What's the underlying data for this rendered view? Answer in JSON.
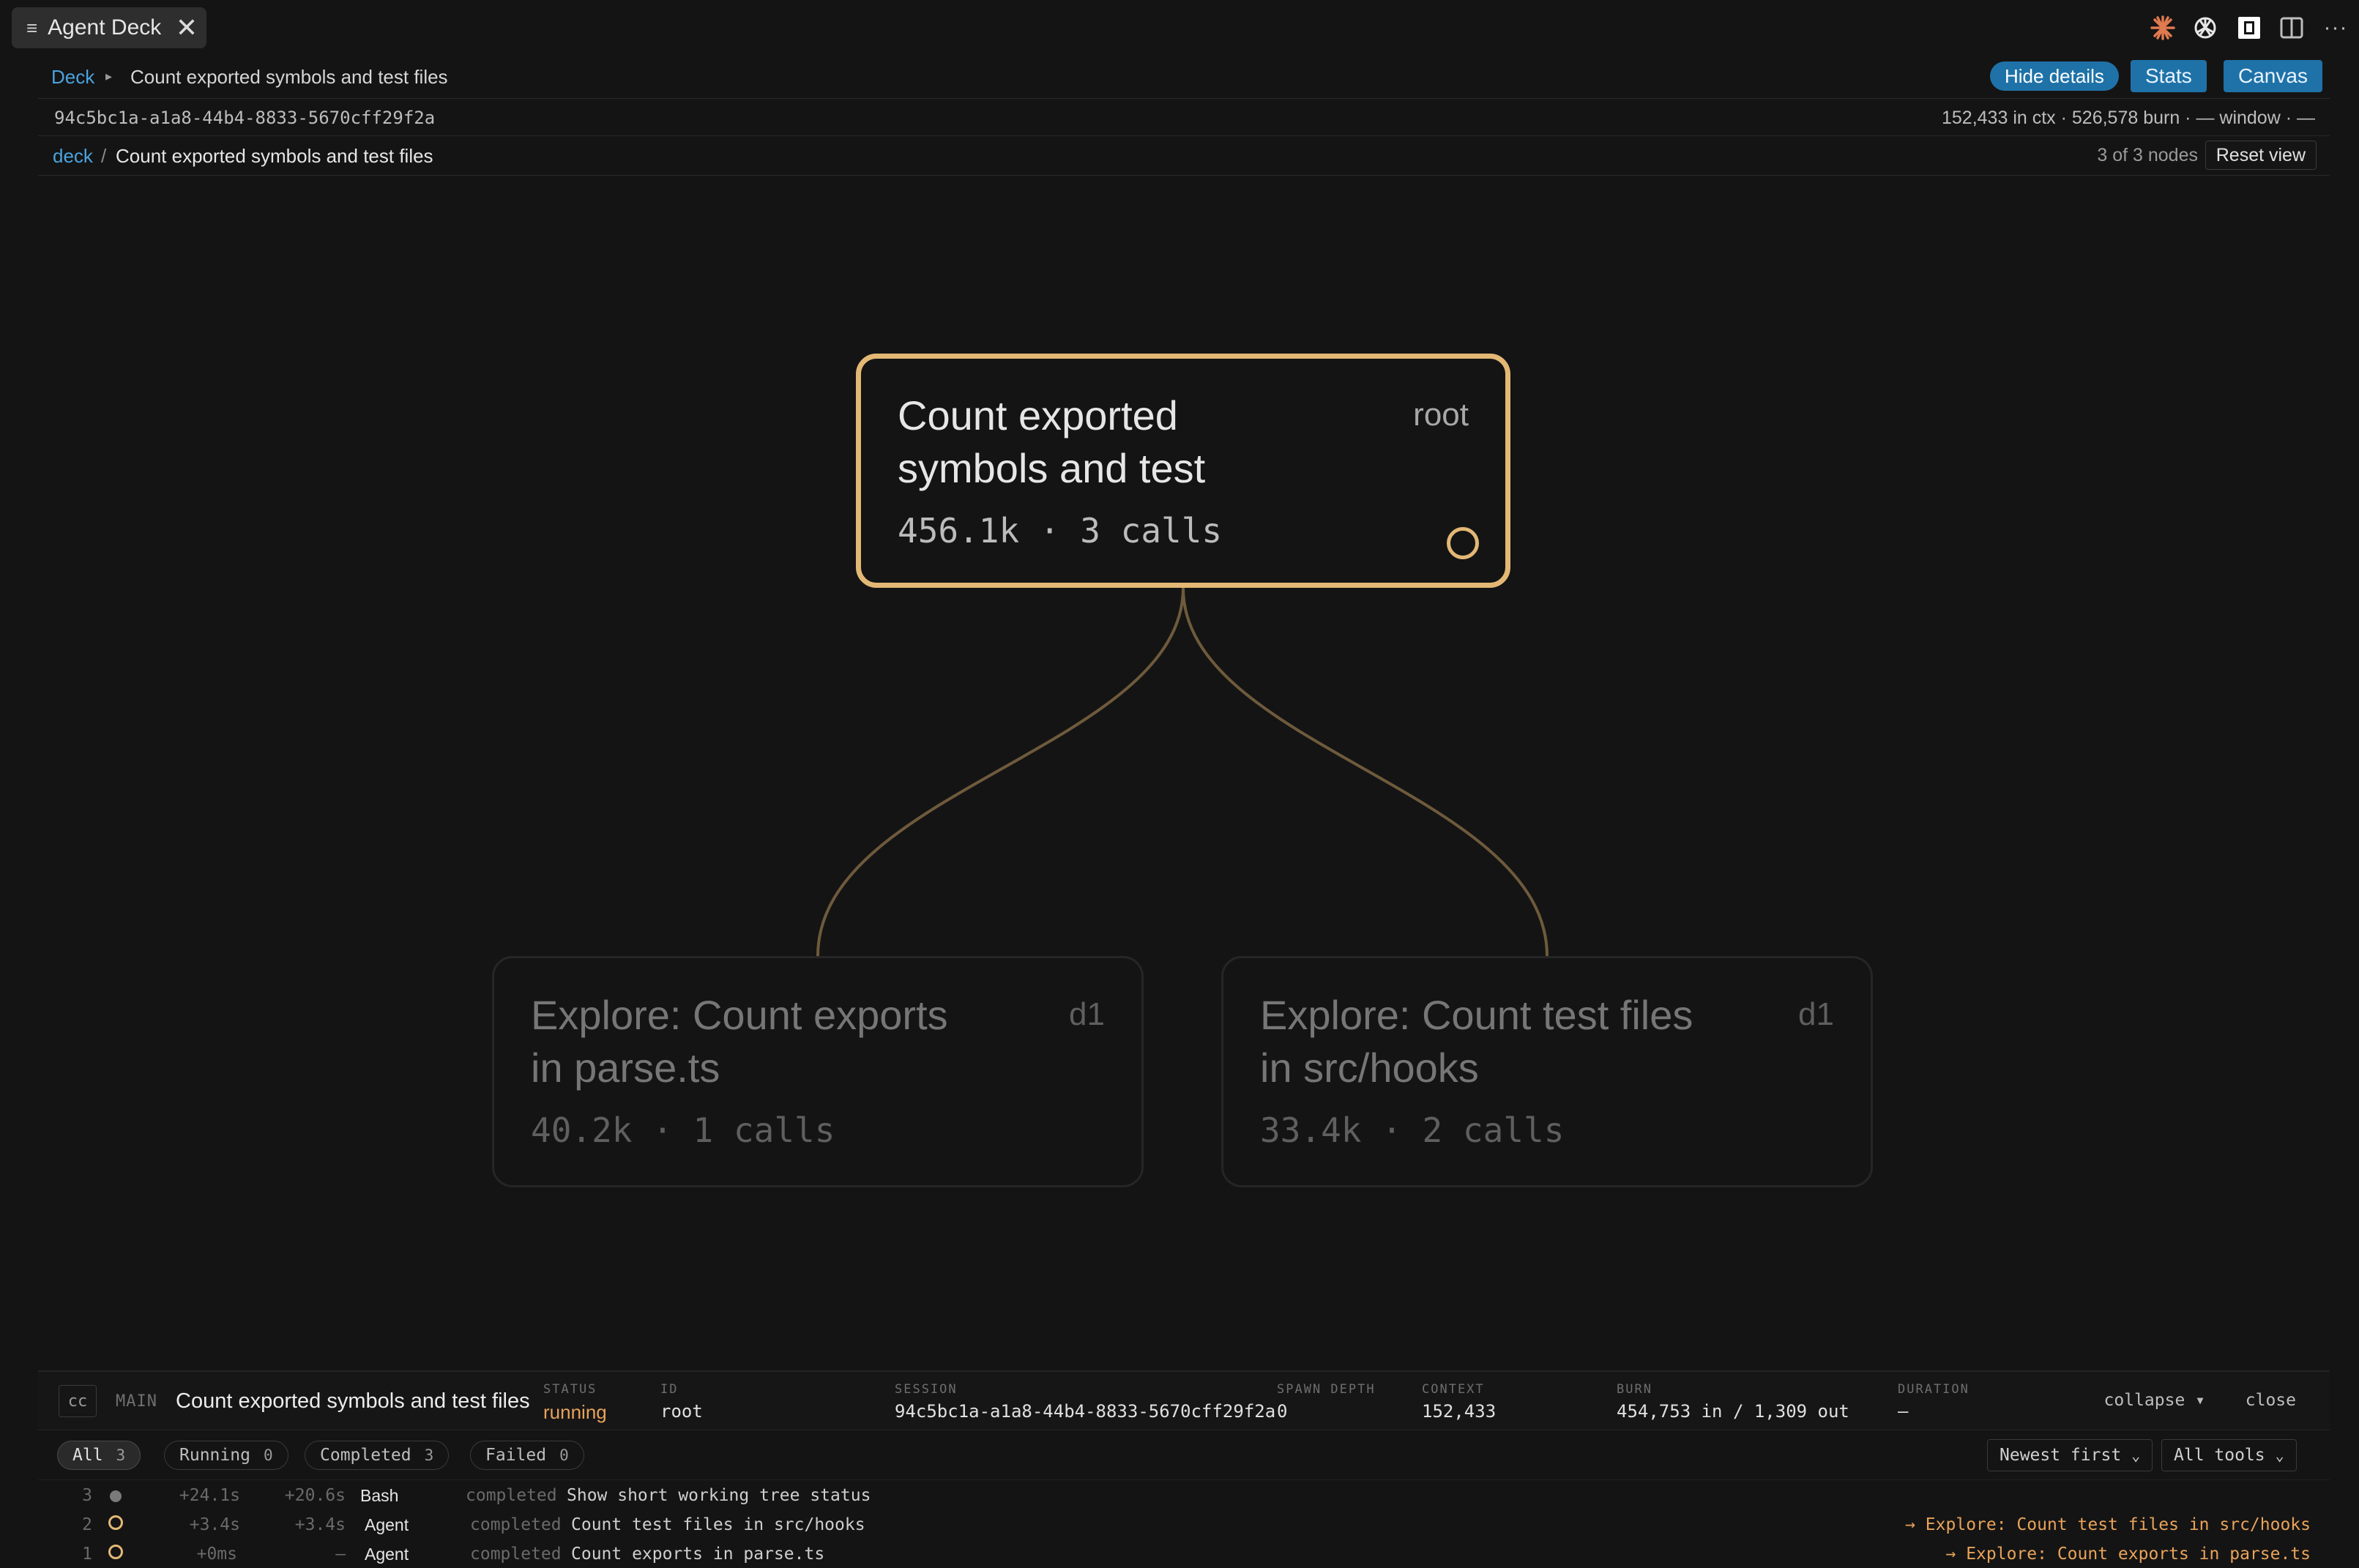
{
  "window": {
    "tab_title": "Agent Deck",
    "tab_menu_icon": "hamburger-icon",
    "tab_close_icon": "close-icon",
    "toolbar_icons": [
      "claude-starburst-icon",
      "openai-icon",
      "panel-toggle-icon",
      "split-view-icon",
      "more-options-icon"
    ]
  },
  "breadcrumb": {
    "root": "Deck",
    "separator": "▸",
    "current": "Count exported symbols and test files"
  },
  "actions": {
    "hide_details": "Hide details",
    "stats": "Stats",
    "canvas": "Canvas"
  },
  "session_bar": {
    "session_id": "94c5bc1a-a1a8-44b4-8833-5670cff29f2a",
    "stats": "152,433 in ctx · 526,578 burn · — window · —"
  },
  "path_bar": {
    "root": "deck",
    "separator": "/",
    "current": "Count exported symbols and test files",
    "node_count": "3 of 3 nodes",
    "reset_view": "Reset view"
  },
  "tree": {
    "root": {
      "title": "Count exported symbols and test",
      "tag": "root",
      "stats": "456.1k · 3 calls",
      "status_icon": "running-ring-icon"
    },
    "children": [
      {
        "title": "Explore: Count exports in parse.ts",
        "tag": "d1",
        "stats": "40.2k · 1 calls"
      },
      {
        "title": "Explore: Count test files in src/hooks",
        "tag": "d1",
        "stats": "33.4k · 2 calls"
      }
    ]
  },
  "details": {
    "badge": "cc",
    "main_label": "MAIN",
    "title": "Count exported symbols and test files",
    "fields": {
      "status": {
        "label": "STATUS",
        "value": "running"
      },
      "id": {
        "label": "ID",
        "value": "root"
      },
      "session": {
        "label": "SESSION",
        "value": "94c5bc1a-a1a8-44b4-8833-5670cff29f2a"
      },
      "spawn_depth": {
        "label": "SPAWN DEPTH",
        "value": "0"
      },
      "context": {
        "label": "CONTEXT",
        "value": "152,433"
      },
      "burn": {
        "label": "BURN",
        "value": "454,753 in / 1,309 out"
      },
      "duration": {
        "label": "DURATION",
        "value": "—"
      }
    },
    "collapse": "collapse ▾",
    "close": "close",
    "filters": [
      {
        "label": "All",
        "count": "3"
      },
      {
        "label": "Running",
        "count": "0"
      },
      {
        "label": "Completed",
        "count": "3"
      },
      {
        "label": "Failed",
        "count": "0"
      }
    ],
    "sort_select": "Newest first",
    "tools_select": "All tools",
    "select_chevron_icon": "chevron-down-icon",
    "events": [
      {
        "num": "3",
        "t1": "+24.1s",
        "t2": "+20.6s",
        "tool": "Bash",
        "status": "completed",
        "desc": "Show short working tree status",
        "link": ""
      },
      {
        "num": "2",
        "t1": "+3.4s",
        "t2": "+3.4s",
        "tool": "Agent",
        "status": "completed",
        "desc": "Count test files in src/hooks",
        "link": "→ Explore: Count test files in src/hooks"
      },
      {
        "num": "1",
        "t1": "+0ms",
        "t2": "–",
        "tool": "Agent",
        "status": "completed",
        "desc": "Count exports in parse.ts",
        "link": "→ Explore: Count exports in parse.ts"
      }
    ]
  },
  "colors": {
    "accent_gold": "#e3b875",
    "link_blue": "#4aa3df",
    "button_blue": "#1f72a8",
    "running_orange": "#e8a35a",
    "background": "#141414"
  }
}
